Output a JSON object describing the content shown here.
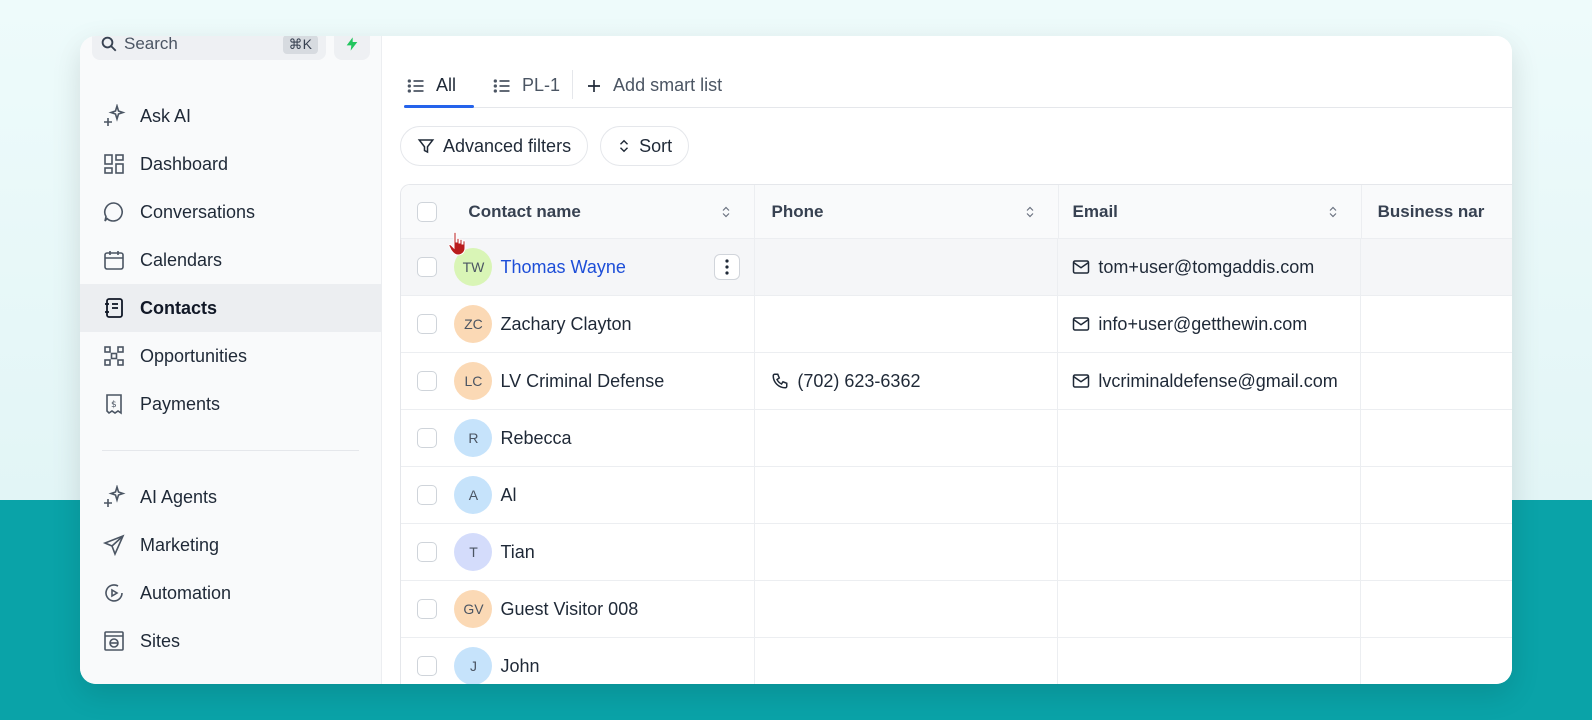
{
  "search": {
    "label": "Search",
    "shortcut": "⌘K"
  },
  "sidebar": {
    "items": [
      {
        "label": "Ask AI",
        "icon": "sparkle-icon"
      },
      {
        "label": "Dashboard",
        "icon": "dashboard-icon"
      },
      {
        "label": "Conversations",
        "icon": "chat-icon"
      },
      {
        "label": "Calendars",
        "icon": "calendar-icon"
      },
      {
        "label": "Contacts",
        "icon": "contacts-icon",
        "active": true
      },
      {
        "label": "Opportunities",
        "icon": "opportunities-icon"
      },
      {
        "label": "Payments",
        "icon": "payments-icon"
      }
    ],
    "items2": [
      {
        "label": "AI Agents",
        "icon": "sparkle-icon"
      },
      {
        "label": "Marketing",
        "icon": "send-icon"
      },
      {
        "label": "Automation",
        "icon": "automation-icon"
      },
      {
        "label": "Sites",
        "icon": "sites-icon"
      }
    ]
  },
  "tabs": [
    {
      "label": "All",
      "active": true
    },
    {
      "label": "PL-1"
    }
  ],
  "add_smart_list": "Add smart list",
  "toolbar": {
    "filters": "Advanced filters",
    "sort": "Sort"
  },
  "table": {
    "columns": [
      "Contact name",
      "Phone",
      "Email",
      "Business nar"
    ],
    "rows": [
      {
        "initials": "TW",
        "color": "#d9f5b6",
        "name": "Thomas Wayne",
        "phone": "",
        "email": "tom+user@tomgaddis.com"
      },
      {
        "initials": "ZC",
        "color": "#fbd9b5",
        "name": "Zachary Clayton",
        "phone": "",
        "email": "info+user@getthewin.com"
      },
      {
        "initials": "LC",
        "color": "#fbd9b5",
        "name": "LV Criminal Defense",
        "phone": "(702) 623-6362",
        "email": "lvcriminaldefense@gmail.com"
      },
      {
        "initials": "R",
        "color": "#c6e3fb",
        "name": "Rebecca",
        "phone": "",
        "email": ""
      },
      {
        "initials": "A",
        "color": "#c6e3fb",
        "name": "Al",
        "phone": "",
        "email": ""
      },
      {
        "initials": "T",
        "color": "#d4dcfb",
        "name": "Tian",
        "phone": "",
        "email": ""
      },
      {
        "initials": "GV",
        "color": "#fbd9b5",
        "name": "Guest Visitor 008",
        "phone": "",
        "email": ""
      },
      {
        "initials": "J",
        "color": "#c6e3fb",
        "name": "John",
        "phone": "",
        "email": ""
      }
    ]
  }
}
